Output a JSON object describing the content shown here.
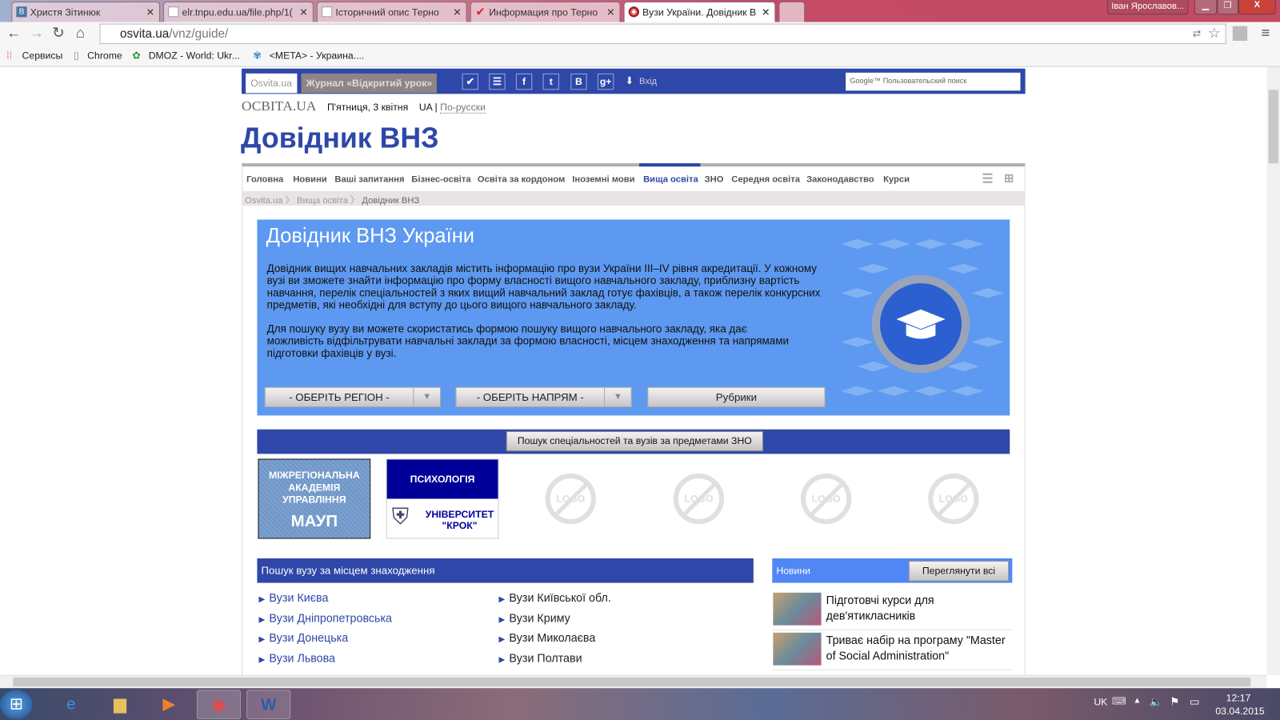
{
  "browser": {
    "tabs": [
      {
        "label": "Христя Зітинюк",
        "icon": "vk-icon"
      },
      {
        "label": "elr.tnpu.edu.ua/file.php/1(",
        "icon": "page-icon"
      },
      {
        "label": "Історичний опис Терно",
        "icon": "page-icon"
      },
      {
        "label": "Информация про Терно",
        "icon": "check-icon"
      },
      {
        "label": "Вузи України. Довідник В",
        "icon": "osvita-icon"
      }
    ],
    "user": "Іван Ярославов...",
    "url_host": "osvita.ua",
    "url_path": "/vnz/guide/",
    "bookmarks": [
      "Сервисы",
      "Chrome",
      "DMOZ - World: Ukr...",
      "<META> - Украина...."
    ]
  },
  "site": {
    "top_tabs": [
      "Osvita.ua",
      "Журнал «Відкритий урок»"
    ],
    "social": [
      "✔",
      "☰",
      "f",
      "t",
      "B",
      "g+"
    ],
    "login": "Вхід",
    "search_placeholder": "Google™ Пользовательский поиск",
    "logo": "ОСВІТА.UA",
    "date": "П'ятниця, 3 квітня",
    "lang_current": "UA",
    "lang_other": "По-русски",
    "heading": "Довідник ВНЗ",
    "menu": [
      "Головна",
      "Новини",
      "Ваші запитання",
      "Бізнес-освіта",
      "Освіта за кордоном",
      "Іноземні мови",
      "Вища освіта",
      "ЗНО",
      "Середня освіта",
      "Законодавство",
      "Курси"
    ],
    "breadcrumbs": [
      "Osvita.ua",
      "Вища освіта",
      "Довідник ВНЗ"
    ]
  },
  "banner": {
    "title": "Довідник ВНЗ України",
    "p1": "Довідник вищих навчальних закладів містить інформацію про вузи України III–IV рівня акредитації. У кожному вузі ви зможете знайти інформацію про форму власності вищого навчального закладу, приблизну вартість навчання, перелік спеціальностей з яких вищий навчальний заклад готує фахівців, а також перелік конкурсних предметів, які необхідні для вступу до цього вищого навчального закладу.",
    "p2": "Для пошуку вузу ви можете скористатись формою пошуку вищого навчального закладу, яка дає можливість відфільтрувати навчальні заклади за формою власності, місцем знаходження та напрямами підготовки фахівців у вузі.",
    "region": "- ОБЕРІТЬ РЕГІОН -",
    "direction": "- ОБЕРІТЬ НАПРЯМ -",
    "rubrics": "Рубрики"
  },
  "zno_button": "Пошук спеціальностей та вузів за предметами ЗНО",
  "logos": {
    "maup_lines": [
      "МІЖРЕГІОНАЛЬНА",
      "АКАДЕМІЯ",
      "УПРАВЛІННЯ"
    ],
    "maup": "МАУП",
    "krok_top": "ПСИХОЛОГІЯ",
    "krok_bottom": "УНІВЕРСИТЕТ \"КРОК\"",
    "placeholder": "LOGO"
  },
  "location": {
    "title": "Пошук вузу за місцем знаходження",
    "col1": [
      "Вузи Києва",
      "Вузи Дніпропетровська",
      "Вузи Донецька",
      "Вузи Львова"
    ],
    "col2": [
      "Вузи Київської обл.",
      "Вузи Криму",
      "Вузи Миколаєва",
      "Вузи Полтави"
    ]
  },
  "news": {
    "title": "Новини",
    "view_all": "Переглянути всі",
    "items": [
      "Підготовчі курси для дев'ятикласників",
      "Триває набір на програму \"Master of Social Administration\""
    ]
  },
  "taskbar": {
    "lang": "UK",
    "time": "12:17",
    "date": "03.04.2015"
  }
}
